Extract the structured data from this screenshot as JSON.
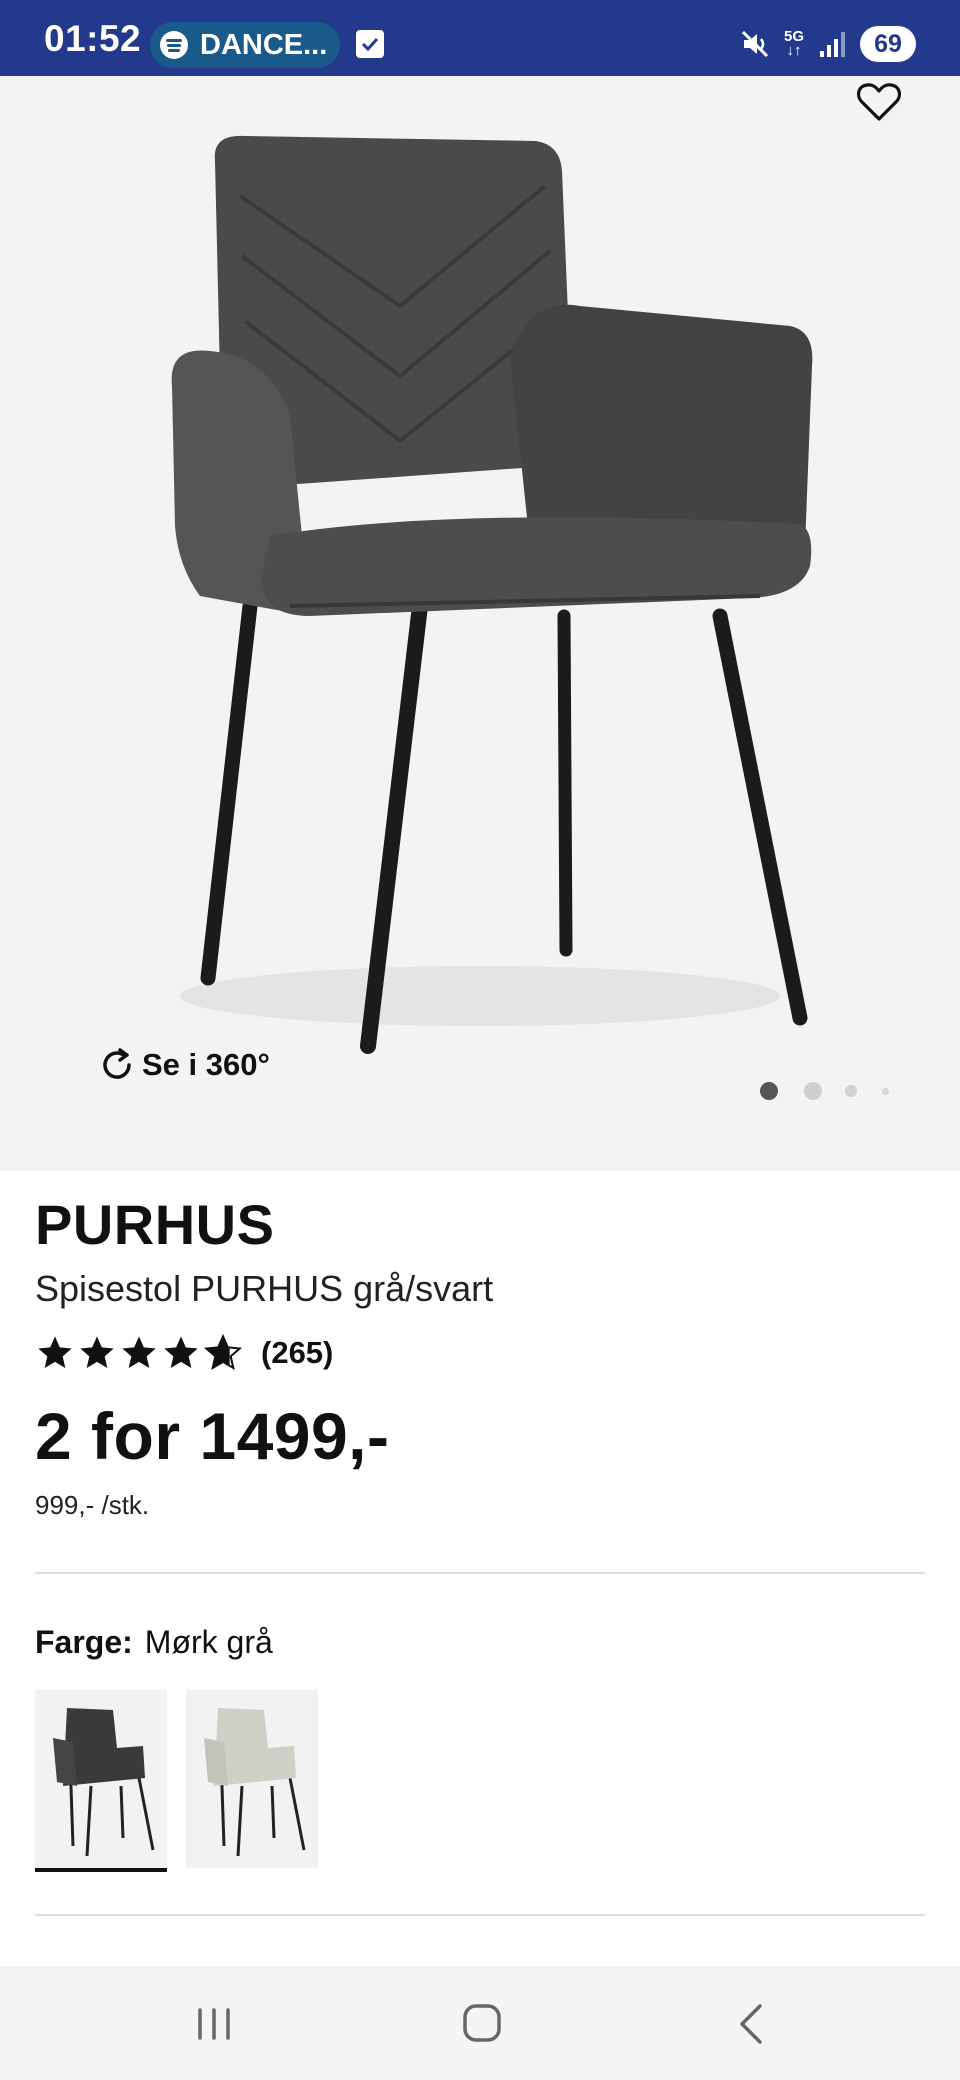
{
  "status_bar": {
    "time": "01:52",
    "media_text": "DANCE...",
    "network_label_top": "5G",
    "network_label_bottom": "↓↑",
    "battery": "69",
    "colors": {
      "background": "#233a8c",
      "pill": "#1a5a8a"
    },
    "icons": [
      "spotify-icon",
      "checkbox-icon",
      "mute-icon",
      "signal-icon",
      "battery-icon"
    ]
  },
  "hero": {
    "view360_label": "Se i 360°",
    "carousel": {
      "total": 4,
      "active": 1
    },
    "icons": [
      "heart-icon",
      "rotate-icon"
    ]
  },
  "product": {
    "brand": "PURHUS",
    "subtitle": "Spisestol PURHUS grå/svart",
    "rating": {
      "value": 4.7,
      "max": 5,
      "count_label": "(265)"
    },
    "price": "2 for 1499,-",
    "unit_price": "999,- /stk."
  },
  "color_selector": {
    "label": "Farge:",
    "value": "Mørk grå",
    "options": [
      {
        "color": "#3a3a3a",
        "selected": true
      },
      {
        "color": "#cfd0c8",
        "selected": false
      }
    ]
  },
  "nav_bar": {
    "icons": [
      "recent-apps-icon",
      "home-icon",
      "back-icon"
    ]
  }
}
